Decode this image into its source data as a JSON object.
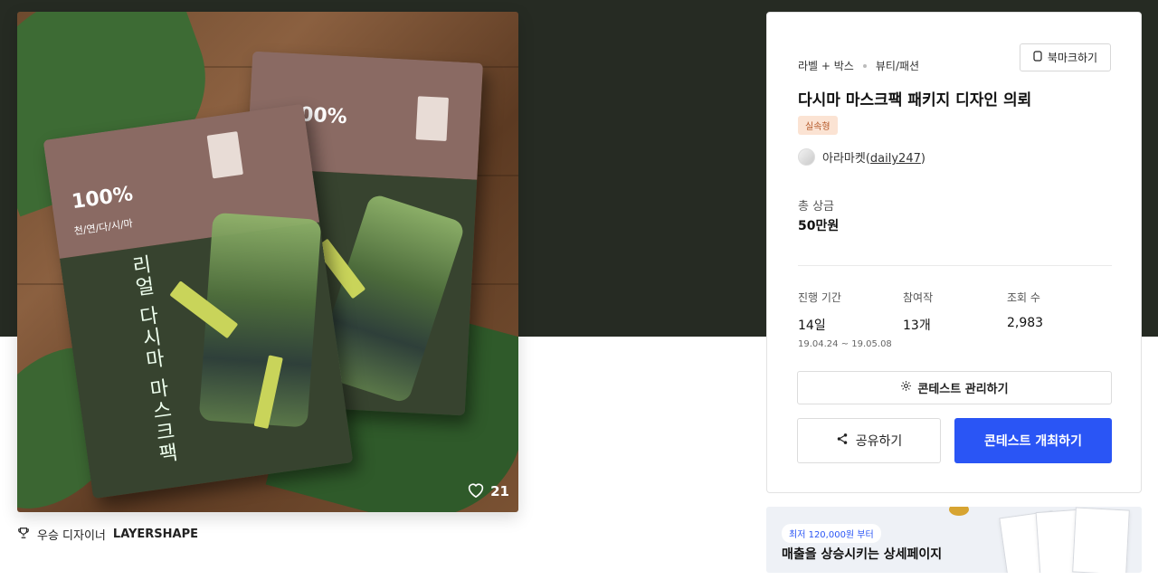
{
  "product": {
    "pack_percent": "100%",
    "pack_subtitle": "천/연/다/시/마",
    "pack_title": "리얼 다시마 마스크팩",
    "likes": "21"
  },
  "award": {
    "prefix": "우승 디자이너",
    "designer": "LAYERSHAPE"
  },
  "card": {
    "breadcrumb": [
      "라벨 + 박스",
      "뷰티/패션"
    ],
    "bookmark_label": "북마크하기",
    "title": "다시마 마스크팩 패키지 디자인 의뢰",
    "badge": "실속형",
    "host_name": "아라마켓",
    "host_handle": "daily247",
    "prize_label": "총 상금",
    "prize_value": "50만원",
    "stats": [
      {
        "label": "진행 기간",
        "value": "14일",
        "sub": "19.04.24 ~ 19.05.08"
      },
      {
        "label": "참여작",
        "value": "13개",
        "sub": ""
      },
      {
        "label": "조회 수",
        "value": "2,983",
        "sub": ""
      }
    ],
    "manage_label": "콘테스트 관리하기",
    "share_label": "공유하기",
    "open_label": "콘테스트 개최하기"
  },
  "ad": {
    "badge": "최저 120,000원 부터",
    "text": "매출을 상승시키는 상세페이지"
  },
  "colors": {
    "hero_bg": "#262b23",
    "primary": "#2a55f5",
    "badge_bg": "#fbe3d3",
    "badge_text": "#b55a2a"
  }
}
